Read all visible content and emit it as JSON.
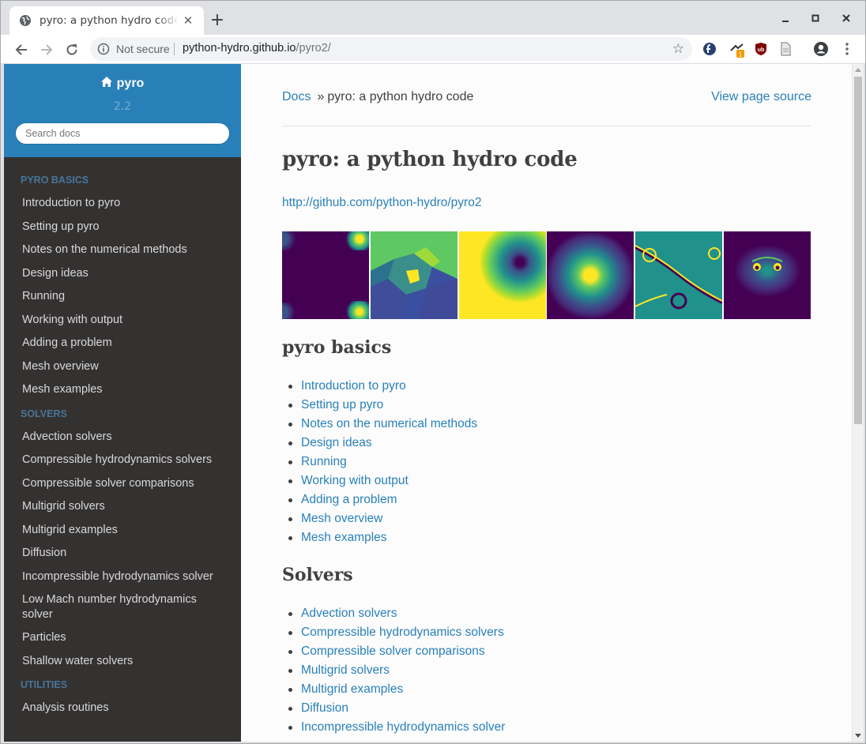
{
  "browser": {
    "tab_title": "pyro: a python hydro code",
    "new_tab_label": "+",
    "security_label": "Not secure",
    "url_host": "python-hydro.github.io",
    "url_path": "/pyro2/",
    "extension_badge": "1",
    "accent_color": "#1a73e8"
  },
  "sidebar": {
    "project_name": "pyro",
    "version": "2.2",
    "search_placeholder": "Search docs",
    "sections": [
      {
        "caption": "Pyro Basics",
        "items": [
          "Introduction to pyro",
          "Setting up pyro",
          "Notes on the numerical methods",
          "Design ideas",
          "Running",
          "Working with output",
          "Adding a problem",
          "Mesh overview",
          "Mesh examples"
        ]
      },
      {
        "caption": "Solvers",
        "items": [
          "Advection solvers",
          "Compressible hydrodynamics solvers",
          "Compressible solver comparisons",
          "Multigrid solvers",
          "Multigrid examples",
          "Diffusion",
          "Incompressible hydrodynamics solver",
          "Low Mach number hydrodynamics solver",
          "Particles",
          "Shallow water solvers"
        ]
      },
      {
        "caption": "Utilities",
        "items": [
          "Analysis routines"
        ]
      }
    ],
    "header_color": "#2980b9",
    "bg_color": "#343131"
  },
  "content": {
    "breadcrumb_home": "Docs",
    "breadcrumb_sep": "»",
    "breadcrumb_current": "pyro: a python hydro code",
    "view_source": "View page source",
    "title": "pyro: a python hydro code",
    "github_link": "http://github.com/python-hydro/pyro2",
    "basics_heading": "pyro basics",
    "basics_items": [
      "Introduction to pyro",
      "Setting up pyro",
      "Notes on the numerical methods",
      "Design ideas",
      "Running",
      "Working with output",
      "Adding a problem",
      "Mesh overview",
      "Mesh examples"
    ],
    "solvers_heading": "Solvers",
    "solvers_items": [
      "Advection solvers",
      "Compressible hydrodynamics solvers",
      "Compressible solver comparisons",
      "Multigrid solvers",
      "Multigrid examples",
      "Diffusion",
      "Incompressible hydrodynamics solver"
    ],
    "link_color": "#2980b9"
  }
}
